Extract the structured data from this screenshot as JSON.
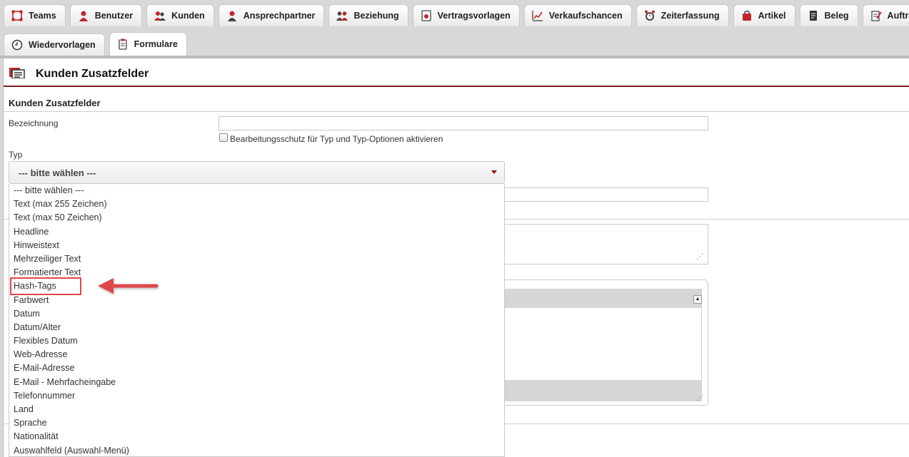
{
  "tabs_row1": [
    {
      "label": "Teams",
      "icon": "teams-icon"
    },
    {
      "label": "Benutzer",
      "icon": "user-icon"
    },
    {
      "label": "Kunden",
      "icon": "customers-icon"
    },
    {
      "label": "Ansprechpartner",
      "icon": "contact-person-icon"
    },
    {
      "label": "Beziehung",
      "icon": "relationship-icon"
    },
    {
      "label": "Vertragsvorlagen",
      "icon": "contract-template-icon"
    },
    {
      "label": "Verkaufschancen",
      "icon": "sales-chart-icon"
    },
    {
      "label": "Zeiterfassung",
      "icon": "alarm-clock-icon"
    },
    {
      "label": "Artikel",
      "icon": "shopping-bag-icon"
    },
    {
      "label": "Beleg",
      "icon": "receipt-icon"
    },
    {
      "label": "Aufträge",
      "icon": "order-icon"
    }
  ],
  "tabs_row2": [
    {
      "label": "Wiedervorlagen",
      "icon": "clock-icon"
    },
    {
      "label": "Formulare",
      "icon": "clipboard-icon"
    }
  ],
  "page": {
    "title": "Kunden Zusatzfelder",
    "section_title": "Kunden Zusatzfelder"
  },
  "form": {
    "bezeichnung_label": "Bezeichnung",
    "bezeichnung_value": "",
    "checkbox_label": "Bearbeitungsschutz für Typ und Typ-Optionen aktivieren",
    "typ_label": "Typ",
    "typ_selected": "--- bitte wählen ---"
  },
  "typ_options": [
    "--- bitte wählen ---",
    "Text (max 255 Zeichen)",
    "Text (max 50 Zeichen)",
    "Headline",
    "Hinweistext",
    "Mehrzeiliger Text",
    "Formatierter Text",
    "Hash-Tags",
    "Farbwert",
    "Datum",
    "Datum/Alter",
    "Flexibles Datum",
    "Web-Adresse",
    "E-Mail-Adresse",
    "E-Mail - Mehrfacheingabe",
    "Telefonnummer",
    "Land",
    "Sprache",
    "Nationalität",
    "Auswahlfeld (Auswahl-Menü)"
  ],
  "annotation": {
    "highlighted_option": "Hash-Tags",
    "color": "#e0474c"
  },
  "colors": {
    "accent": "#7a1f1f",
    "icon_red": "#c0272d"
  }
}
